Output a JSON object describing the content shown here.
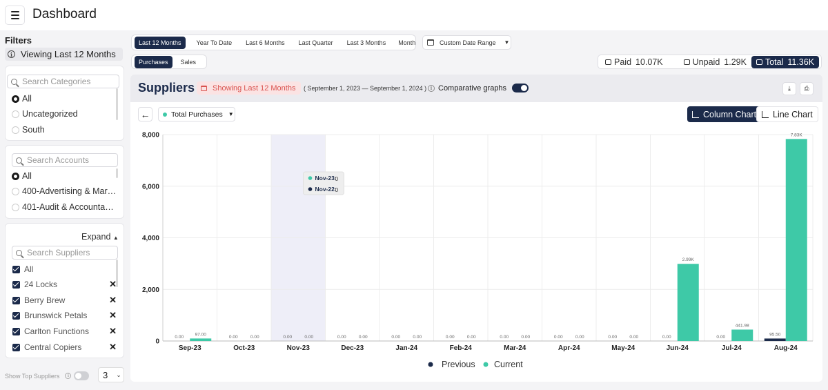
{
  "app": {
    "title": "Dashboard"
  },
  "sidebar": {
    "filters_title": "Filters",
    "viewing": "Viewing Last 12 Months",
    "categories": {
      "placeholder": "Search Categories",
      "items": [
        {
          "label": "All",
          "checked": true
        },
        {
          "label": "Uncategorized",
          "checked": false
        },
        {
          "label": "South",
          "checked": false
        }
      ]
    },
    "accounts": {
      "placeholder": "Search Accounts",
      "items": [
        {
          "label": "All",
          "checked": true
        },
        {
          "label": "400-Advertising & Mar…",
          "checked": false
        },
        {
          "label": "401-Audit & Accounta…",
          "checked": false
        }
      ]
    },
    "suppliers": {
      "expand_label": "Expand",
      "placeholder": "Search Suppliers",
      "items": [
        {
          "label": "All"
        },
        {
          "label": "24 Locks"
        },
        {
          "label": "Berry Brew"
        },
        {
          "label": "Brunswick Petals"
        },
        {
          "label": "Carlton Functions"
        },
        {
          "label": "Central Copiers"
        }
      ]
    },
    "show_top_label": "Show Top Suppliers",
    "top_count": "3"
  },
  "periods": [
    "Last 12 Months",
    "Year To Date",
    "Last 6 Months",
    "Last Quarter",
    "Last 3 Months",
    "Month"
  ],
  "active_period": "Last 12 Months",
  "custom_range_label": "Custom Date Range",
  "modes": [
    "Purchases",
    "Sales"
  ],
  "active_mode": "Purchases",
  "totals": {
    "paid_label": "Paid",
    "paid_value": "10.07K",
    "unpaid_label": "Unpaid",
    "unpaid_value": "1.29K",
    "total_label": "Total",
    "total_value": "11.36K"
  },
  "card": {
    "title": "Suppliers",
    "showing": "Showing Last 12 Months",
    "range": "( September 1, 2023 — September 1, 2024 )",
    "comparative_label": "Comparative graphs",
    "series_select": "Total Purchases",
    "column_chart_label": "Column Chart",
    "line_chart_label": "Line Chart",
    "back_arrow": "←",
    "download_icon": "download-icon",
    "export_icon": "export-icon"
  },
  "colors": {
    "previous": "#1b2a4a",
    "current": "#3ec9a7",
    "accent": "#1b2a4a",
    "highlight": "#eeeef8"
  },
  "chart_data": {
    "type": "bar",
    "categories": [
      "Sep-23",
      "Oct-23",
      "Nov-23",
      "Dec-23",
      "Jan-24",
      "Feb-24",
      "Mar-24",
      "Apr-24",
      "May-24",
      "Jun-24",
      "Jul-24",
      "Aug-24"
    ],
    "series": [
      {
        "name": "Previous",
        "values": [
          0,
          0,
          0,
          0,
          0,
          0,
          0,
          0,
          0,
          0,
          0,
          95.5
        ],
        "labels": [
          "0.00",
          "0.00",
          "0.00",
          "0.00",
          "0.00",
          "0.00",
          "0.00",
          "0.00",
          "0.00",
          "0.00",
          "0.00",
          "95.50"
        ]
      },
      {
        "name": "Current",
        "values": [
          97,
          0,
          0,
          0,
          0,
          0,
          0,
          0,
          0,
          2990,
          441.98,
          7830
        ],
        "labels": [
          "97.00",
          "0.00",
          "0.00",
          "0.00",
          "0.00",
          "0.00",
          "0.00",
          "0.00",
          "0.00",
          "2.99K",
          "441.98",
          "7.83K"
        ]
      }
    ],
    "ylim": [
      0,
      8000
    ],
    "yticks": [
      "0",
      "2,000",
      "4,000",
      "6,000",
      "8,000"
    ],
    "ytick_values": [
      0,
      2000,
      4000,
      6000,
      8000
    ],
    "grid": true,
    "legend": "bottom",
    "highlighted_category": "Nov-23",
    "tooltip": [
      {
        "label": "Nov-23:",
        "value": "0"
      },
      {
        "label": "Nov-22:",
        "value": "0"
      }
    ]
  }
}
